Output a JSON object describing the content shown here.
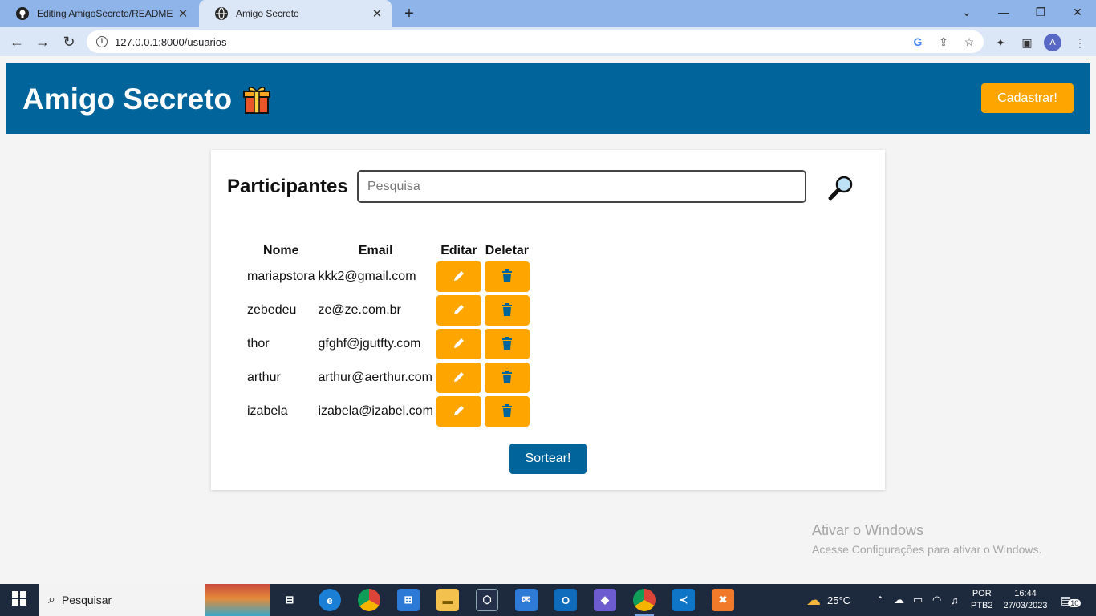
{
  "browser": {
    "tabs": [
      {
        "title": "Editing AmigoSecreto/README.m",
        "icon": "github-icon"
      },
      {
        "title": "Amigo Secreto",
        "icon": "globe-icon"
      }
    ],
    "url": "127.0.0.1:8000/usuarios",
    "profile_initial": "A"
  },
  "header": {
    "brand": "Amigo Secreto",
    "brand_icon": "gift-icon",
    "cadastrar_label": "Cadastrar!"
  },
  "participants": {
    "title": "Participantes",
    "search_placeholder": "Pesquisa",
    "columns": [
      "Nome",
      "Email",
      "Editar",
      "Deletar"
    ],
    "rows": [
      {
        "nome": "mariapstora",
        "email": "kkk2@gmail.com"
      },
      {
        "nome": "zebedeu",
        "email": "ze@ze.com.br"
      },
      {
        "nome": "thor",
        "email": "gfghf@jgutfty.com"
      },
      {
        "nome": "arthur",
        "email": "arthur@aerthur.com"
      },
      {
        "nome": "izabela",
        "email": "izabela@izabel.com"
      }
    ],
    "sortear_label": "Sortear!"
  },
  "watermark": {
    "line1": "Ativar o Windows",
    "line2": "Acesse Configurações para ativar o Windows."
  },
  "taskbar": {
    "search_label": "Pesquisar",
    "weather": "25°C",
    "lang1": "POR",
    "lang2": "PTB2",
    "time": "16:44",
    "date": "27/03/2023",
    "notifications": "10"
  },
  "colors": {
    "header_bg": "#01649b",
    "accent": "#ffa500",
    "icon_blue": "#01649b"
  }
}
